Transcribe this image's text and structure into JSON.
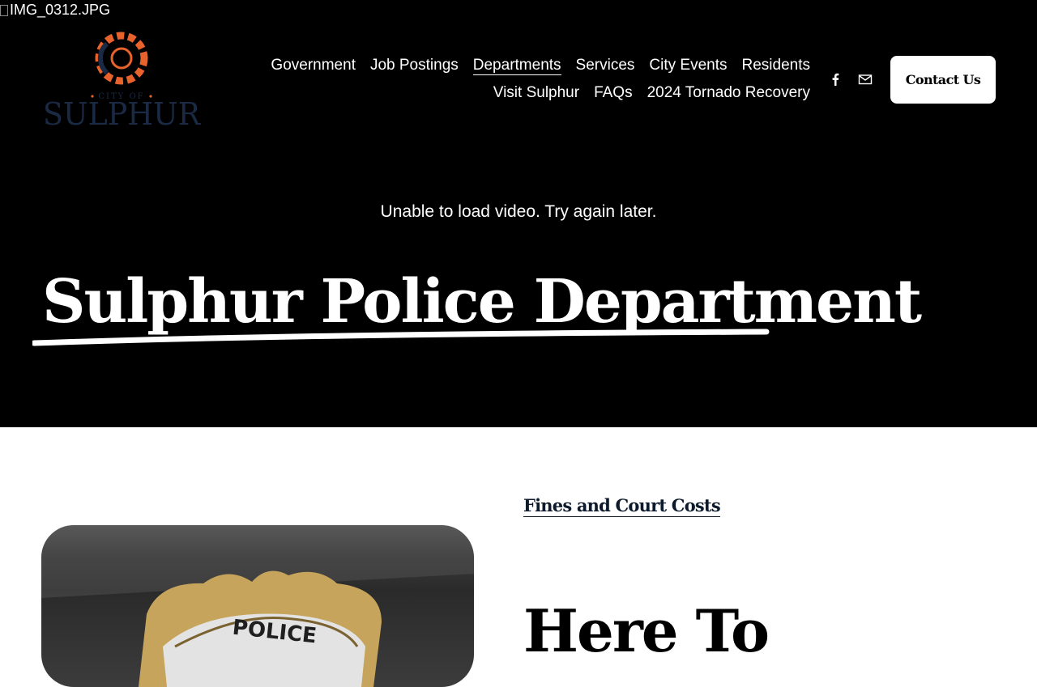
{
  "broken_image_alt": "IMG_0312.JPG",
  "logo": {
    "top_text": "CITY OF",
    "name": "SULPHUR"
  },
  "nav": {
    "row1": [
      {
        "label": "Government",
        "active": false
      },
      {
        "label": "Job Postings",
        "active": false
      },
      {
        "label": "Departments",
        "active": true
      },
      {
        "label": "Services",
        "active": false
      },
      {
        "label": "City Events",
        "active": false
      },
      {
        "label": "Residents",
        "active": false
      }
    ],
    "row2": [
      {
        "label": "Visit Sulphur",
        "active": false
      },
      {
        "label": "FAQs",
        "active": false
      },
      {
        "label": "2024 Tornado Recovery",
        "active": false
      }
    ]
  },
  "social": {
    "facebook_icon": "facebook-icon",
    "email_icon": "email-icon"
  },
  "contact_button": "Contact Us",
  "video_error": "Unable to load video. Try again later.",
  "hero_title": "Sulphur Police Department",
  "fines_link": "Fines and Court Costs",
  "badge_text": "POLICE",
  "section_heading": "Here To",
  "colors": {
    "logo_orange": "#e8622c",
    "logo_navy": "#1b2a44",
    "hero_bg": "#000000",
    "link_navy": "#0d1a2b"
  }
}
